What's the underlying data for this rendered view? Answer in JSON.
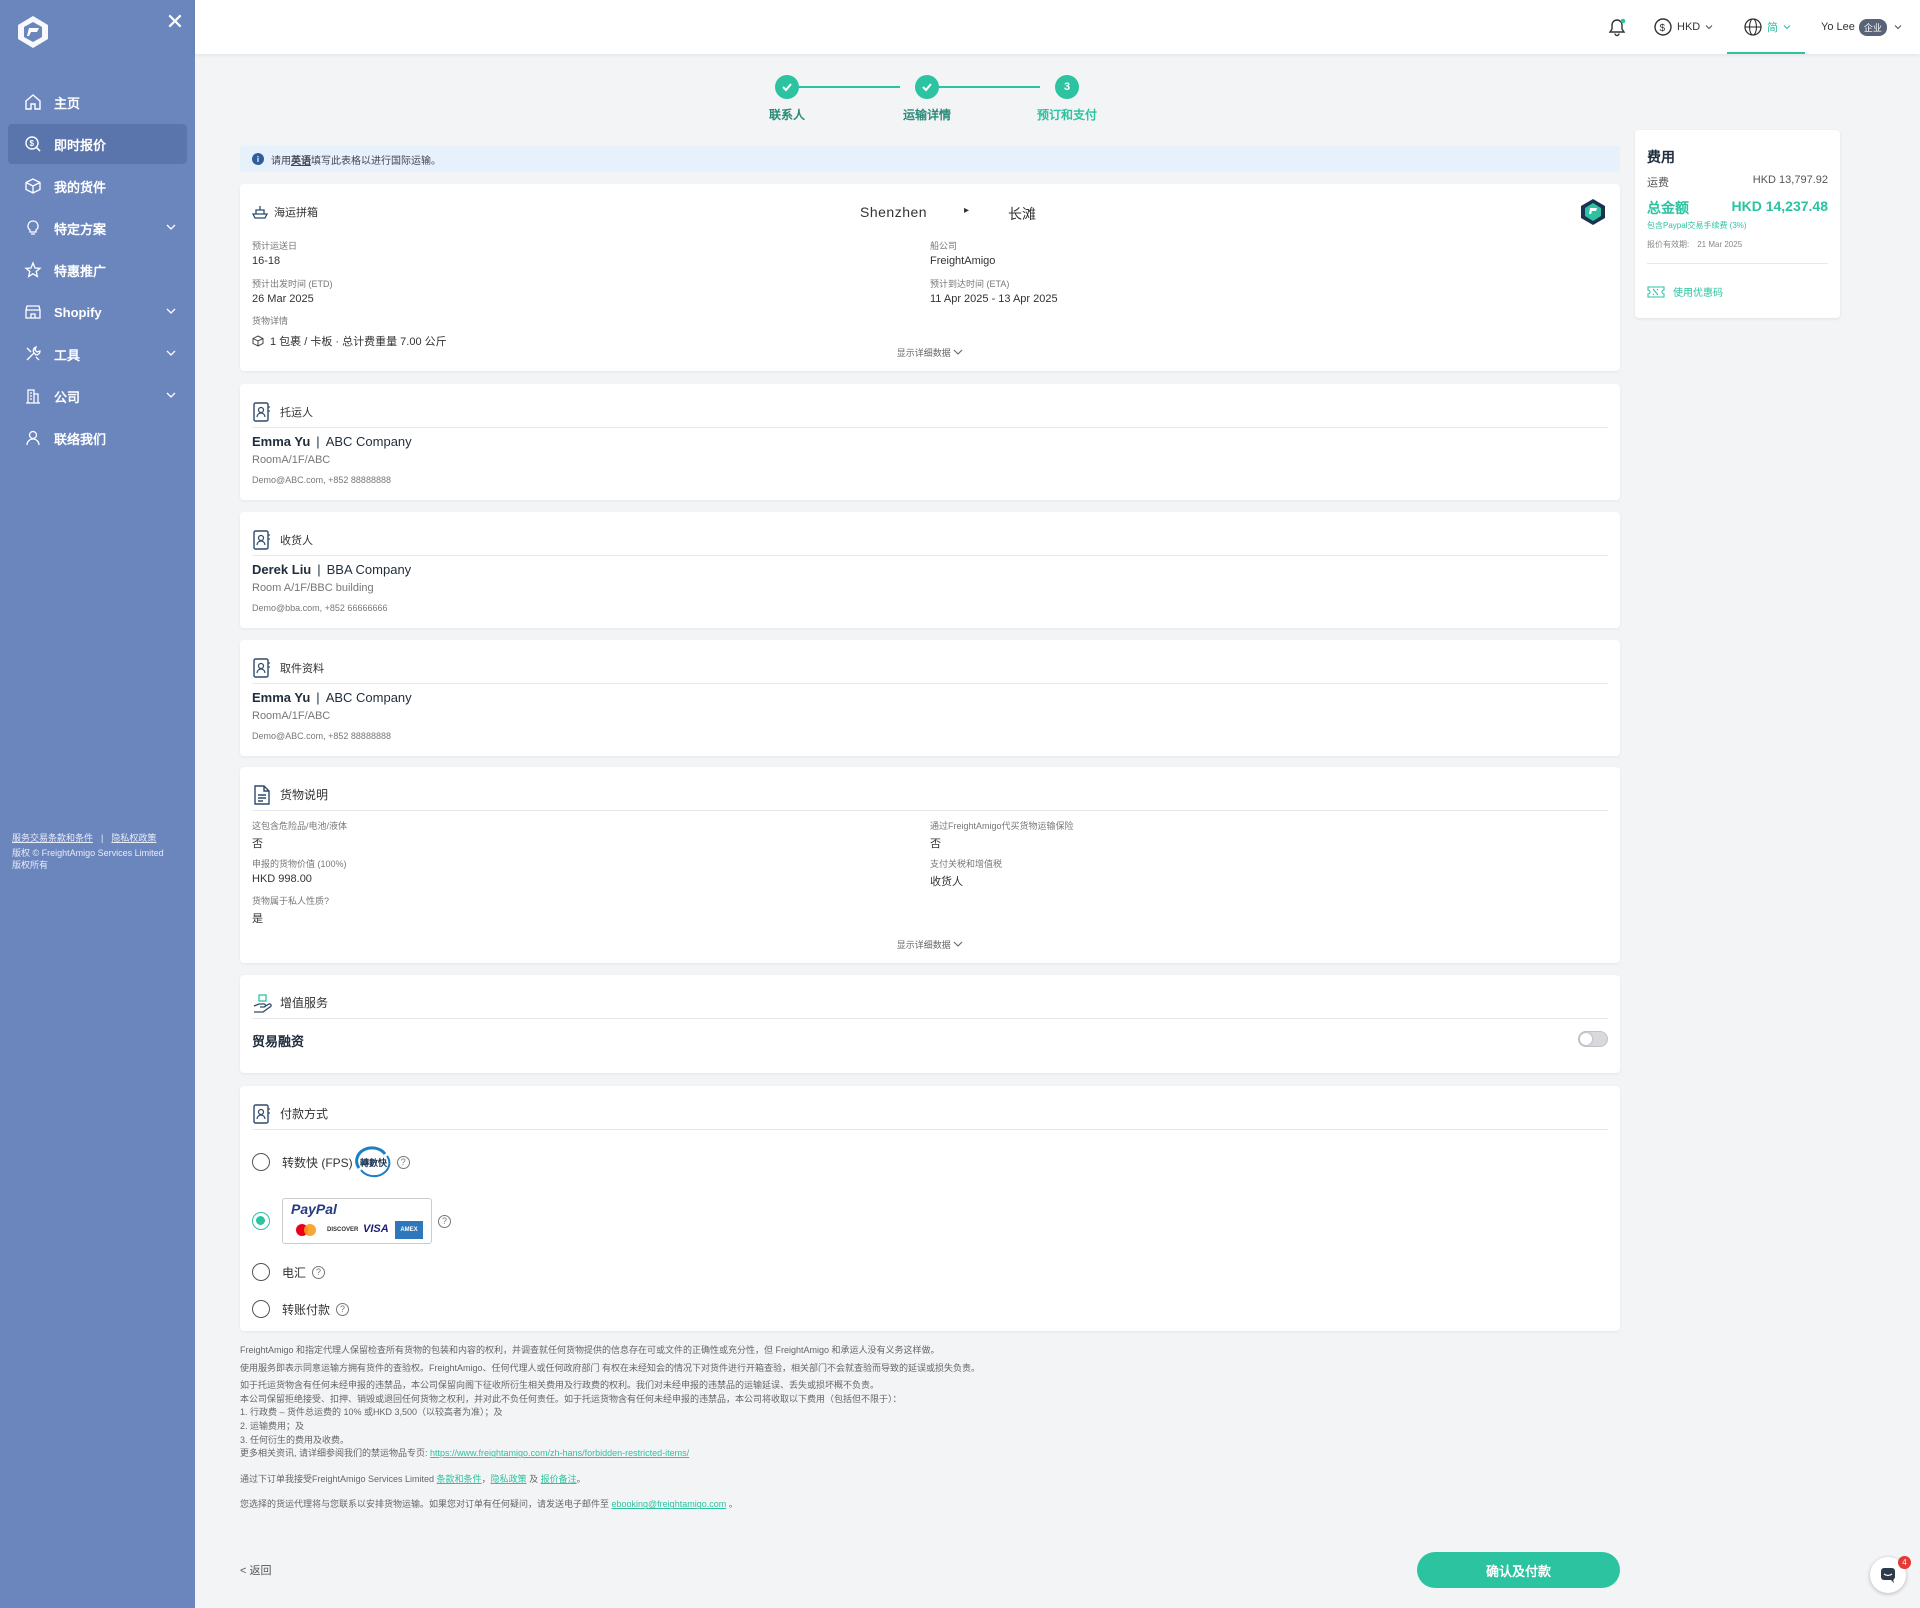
{
  "sidebar": {
    "items": [
      {
        "label": "主页",
        "icon": "home-icon"
      },
      {
        "label": "即时报价",
        "icon": "quote-icon",
        "active": true
      },
      {
        "label": "我的货件",
        "icon": "box-icon"
      },
      {
        "label": "特定方案",
        "icon": "bulb-icon",
        "expandable": true
      },
      {
        "label": "特惠推广",
        "icon": "star-icon"
      },
      {
        "label": "Shopify",
        "icon": "shop-icon",
        "expandable": true
      },
      {
        "label": "工具",
        "icon": "tools-icon",
        "expandable": true
      },
      {
        "label": "公司",
        "icon": "building-icon",
        "expandable": true
      },
      {
        "label": "联络我们",
        "icon": "contact-icon"
      }
    ],
    "footer": {
      "link1": "服务交易条款和条件",
      "sep": "|",
      "link2": "隐私权政策",
      "copyright": "版权 © FreightAmigo Services Limited",
      "rights": "版权所有"
    }
  },
  "topbar": {
    "currency": "HKD",
    "language": "简",
    "user": "Yo Lee",
    "user_badge": "企业"
  },
  "stepper": {
    "steps": [
      {
        "label": "联系人",
        "state": "done"
      },
      {
        "label": "运输详情",
        "state": "done"
      },
      {
        "label": "预订和支付",
        "state": "current",
        "number": "3"
      }
    ]
  },
  "notice": {
    "prefix": "请用",
    "highlight": "英语",
    "suffix": "填写此表格以进行国际运输。"
  },
  "shipment": {
    "mode": "海运拼箱",
    "origin": "Shenzhen",
    "arrow": "▸",
    "destination": "长滩",
    "transit_label": "预计运送日",
    "transit_value": "16-18",
    "carrier_label": "船公司",
    "carrier_value": "FreightAmigo",
    "etd_label": "预计出发时间 (ETD)",
    "etd_value": "26 Mar 2025",
    "eta_label": "预计到达时间 (ETA)",
    "eta_value": "11 Apr 2025 - 13 Apr 2025",
    "cargo_label": "货物详情",
    "cargo_value": "1 包裹 / 卡板  ·  总计费重量 7.00 公斤",
    "show_more": "显示详细数据"
  },
  "shipper": {
    "title": "托运人",
    "name": "Emma Yu",
    "company": "ABC Company",
    "address": "RoomA/1F/ABC",
    "contact": "Demo@ABC.com,  +852 88888888"
  },
  "consignee": {
    "title": "收货人",
    "name": "Derek Liu",
    "company": "BBA Company",
    "address": "Room A/1F/BBC building",
    "contact": "Demo@bba.com,  +852 66666666"
  },
  "pickup": {
    "title": "取件资料",
    "name": "Emma Yu",
    "company": "ABC Company",
    "address": "RoomA/1F/ABC",
    "contact": "Demo@ABC.com,  +852 88888888"
  },
  "cargo": {
    "title": "货物说明",
    "dg_label": "这包含危险品/电池/液体",
    "dg_value": "否",
    "insurance_label": "通过FreightAmigo代买货物运输保险",
    "insurance_value": "否",
    "declared_label": "申报的货物价值 (100%)",
    "declared_value": "HKD 998.00",
    "duty_label": "支付关税和增值税",
    "duty_value": "收货人",
    "personal_label": "货物属于私人性质?",
    "personal_value": "是",
    "show_more": "显示详细数据"
  },
  "vas": {
    "title": "增值服务",
    "trade_finance": "贸易融资",
    "trade_finance_on": false
  },
  "payment": {
    "title": "付款方式",
    "options": [
      {
        "label": "转数快 (FPS)",
        "logo_text": "轉數快"
      },
      {
        "label": "",
        "logo_text": "PayPal",
        "cards": [
          "DISCOVER",
          "VISA",
          "AMEX"
        ],
        "selected": true
      },
      {
        "label": "电汇"
      },
      {
        "label": "转账付款"
      }
    ],
    "help": "?"
  },
  "legal": {
    "l1": "FreightAmigo 和指定代理人保留检查所有货物的包装和内容的权利，并调查就任何货物提供的信息存在可或文件的正确性或充分性，但 FreightAmigo 和承运人没有义务这样做。",
    "l2": "使用服务即表示同意运输方拥有货件的查验权。FreightAmigo、任何代理人或任何政府部门 有权在未经知会的情况下对货件进行开箱查验，相关部门不会就查验而导致的延误或损失负责。",
    "l3": "如于托运货物含有任何未经申报的违禁品，本公司保留向阁下征收所衍生相关费用及行政费的权利。我们对未经申报的违禁品的运输延误、丢失或损坏概不负责。",
    "l4": "本公司保留拒绝接受、扣押、销毁或退回任何货物之权利，并对此不负任何责任。如于托运货物含有任何未经申报的违禁品，本公司将收取以下费用（包括但不限于）：",
    "l5": "1. 行政费 – 货件总运费的 10% 或HKD 3,500（以较高者为准）；及",
    "l6": "2. 运输费用；及",
    "l7": "3. 任何衍生的费用及收费。",
    "l8_prefix": "更多相关资讯, 请详细参阅我们的禁运物品专页: ",
    "l8_link": "https://www.freightamigo.com/zh-hans/forbidden-restricted-items/",
    "l9_prefix": "通过下订单我接受FreightAmigo Services Limited ",
    "l9_link1": "条款和条件",
    "l9_mid": "，",
    "l9_link2": "隐私政策",
    "l9_and": " 及 ",
    "l9_link3": "报价备注",
    "l9_end": "。",
    "l10_prefix": "您选择的货运代理将与您联系以安排货物运输。如果您对订单有任何疑问，请发送电子邮件至 ",
    "l10_link": "ebooking@freightamigo.com",
    "l10_end": " 。"
  },
  "actions": {
    "back": "< 返回",
    "confirm": "确认及付款"
  },
  "fee": {
    "title": "费用",
    "freight_label": "运费",
    "freight_value": "HKD 13,797.92",
    "total_label": "总金额",
    "total_value": "HKD 14,237.48",
    "paypal_note": "包含Paypal交易手续费 (3%)",
    "validity_label": "报价有效期:",
    "validity_value": "21 Mar 2025",
    "coupon": "使用优惠码"
  },
  "chat": {
    "badge": "4"
  },
  "colors": {
    "accent": "#2cc3a0",
    "sidebar": "#6b85bd",
    "active_nav": "#5a74ac",
    "notice_bg": "#e7f1fb"
  }
}
